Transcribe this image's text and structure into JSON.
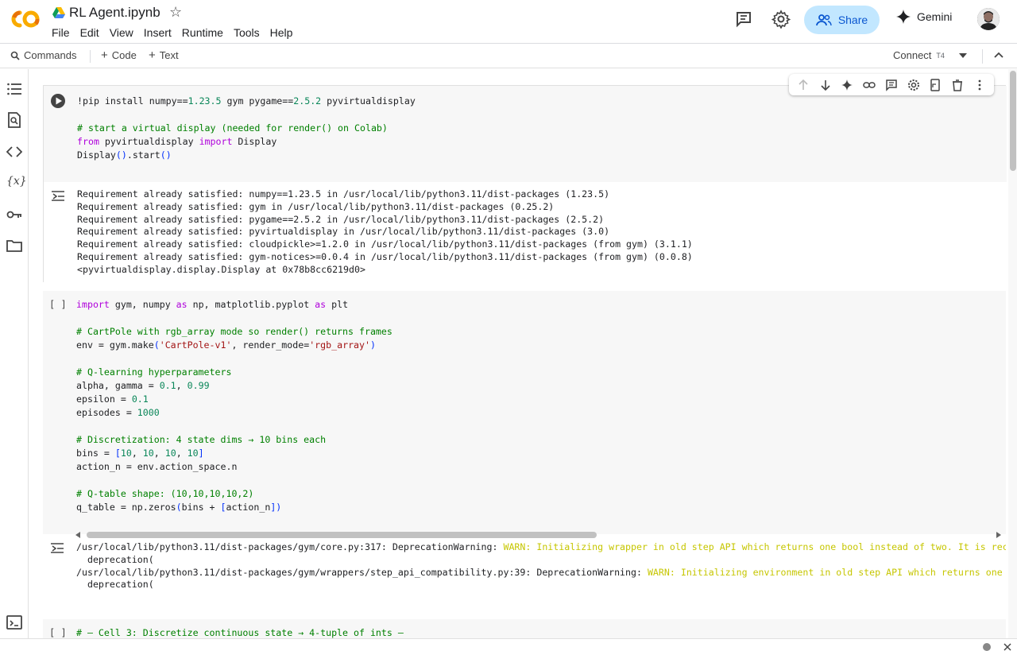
{
  "header": {
    "title": "RL Agent.ipynb",
    "menu": [
      "File",
      "Edit",
      "View",
      "Insert",
      "Runtime",
      "Tools",
      "Help"
    ],
    "share_label": "Share",
    "gemini_label": "Gemini"
  },
  "toolbar": {
    "commands_label": "Commands",
    "code_label": "Code",
    "text_label": "Text",
    "connect_label": "Connect",
    "runtime_type": "T4"
  },
  "cells": [
    {
      "type": "code",
      "status": "run",
      "lines": [
        "!pip install numpy==1.23.5 gym pygame==2.5.2 pyvirtualdisplay",
        "",
        "# start a virtual display (needed for render() on Colab)",
        "from pyvirtualdisplay import Display",
        "Display().start()"
      ],
      "output": [
        "Requirement already satisfied: numpy==1.23.5 in /usr/local/lib/python3.11/dist-packages (1.23.5)",
        "Requirement already satisfied: gym in /usr/local/lib/python3.11/dist-packages (0.25.2)",
        "Requirement already satisfied: pygame==2.5.2 in /usr/local/lib/python3.11/dist-packages (2.5.2)",
        "Requirement already satisfied: pyvirtualdisplay in /usr/local/lib/python3.11/dist-packages (3.0)",
        "Requirement already satisfied: cloudpickle>=1.2.0 in /usr/local/lib/python3.11/dist-packages (from gym) (3.1.1)",
        "Requirement already satisfied: gym-notices>=0.0.4 in /usr/local/lib/python3.11/dist-packages (from gym) (0.0.8)",
        "<pyvirtualdisplay.display.Display at 0x78b8cc6219d0>"
      ]
    },
    {
      "type": "code",
      "status": "[ ]",
      "lines": [
        "import gym, numpy as np, matplotlib.pyplot as plt",
        "",
        "# CartPole with rgb_array mode so render() returns frames",
        "env = gym.make('CartPole-v1', render_mode='rgb_array')",
        "",
        "# Q-learning hyperparameters",
        "alpha, gamma = 0.1, 0.99",
        "epsilon = 0.1",
        "episodes = 1000",
        "",
        "# Discretization: 4 state dims → 10 bins each",
        "bins = [10, 10, 10, 10]",
        "action_n = env.action_space.n",
        "",
        "# Q-table shape: (10,10,10,10,2)",
        "q_table = np.zeros(bins + [action_n])"
      ],
      "output_warn": [
        {
          "prefix": "/usr/local/lib/python3.11/dist-packages/gym/core.py:317: DeprecationWarning: ",
          "warn": "WARN: Initializing wrapper in old step API which returns one bool instead of two. It is reco"
        },
        {
          "prefix": "  deprecation(",
          "warn": ""
        },
        {
          "prefix": "/usr/local/lib/python3.11/dist-packages/gym/wrappers/step_api_compatibility.py:39: DeprecationWarning: ",
          "warn": "WARN: Initializing environment in old step API which returns one b"
        },
        {
          "prefix": "  deprecation(",
          "warn": ""
        }
      ]
    },
    {
      "type": "code",
      "status": "[ ]",
      "lines": [
        "# — Cell 3: Discretize continuous state → 4-tuple of ints —"
      ]
    }
  ],
  "colors": {
    "accent": "#c2e7ff",
    "keyword": "#af00db",
    "comment": "#008000",
    "number": "#098658",
    "string": "#a31515",
    "warning": "#c6c600"
  }
}
